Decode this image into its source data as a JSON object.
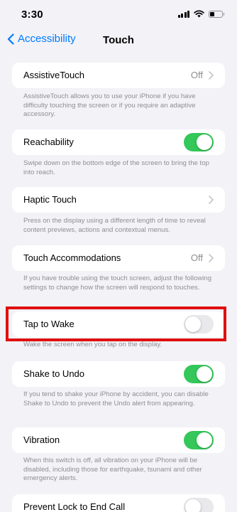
{
  "status": {
    "time": "3:30"
  },
  "nav": {
    "back_label": "Accessibility",
    "title": "Touch"
  },
  "rows": {
    "assistive_touch": {
      "label": "AssistiveTouch",
      "value": "Off",
      "footer": "AssistiveTouch allows you to use your iPhone if you have difficulty touching the screen or if you require an adaptive accessory."
    },
    "reachability": {
      "label": "Reachability",
      "state": "on",
      "footer": "Swipe down on the bottom edge of the screen to bring the top into reach."
    },
    "haptic_touch": {
      "label": "Haptic Touch",
      "footer": "Press on the display using a different length of time to reveal content previews, actions and contextual menus."
    },
    "touch_accommodations": {
      "label": "Touch Accommodations",
      "value": "Off",
      "footer": "If you have trouble using the touch screen, adjust the following settings to change how the screen will respond to touches."
    },
    "tap_to_wake": {
      "label": "Tap to Wake",
      "state": "off",
      "footer": "Wake the screen when you tap on the display."
    },
    "shake_to_undo": {
      "label": "Shake to Undo",
      "state": "on",
      "footer": "If you tend to shake your iPhone by accident, you can disable Shake to Undo to prevent the Undo alert from appearing."
    },
    "vibration": {
      "label": "Vibration",
      "state": "on",
      "footer": "When this switch is off, all vibration on your iPhone will be disabled, including those for earthquake, tsunami and other emergency alerts."
    },
    "prevent_lock": {
      "label": "Prevent Lock to End Call",
      "state": "off"
    }
  },
  "colors": {
    "accent": "#007aff",
    "toggle_on": "#34c759",
    "highlight": "#e01010",
    "background": "#f2f2f7"
  }
}
